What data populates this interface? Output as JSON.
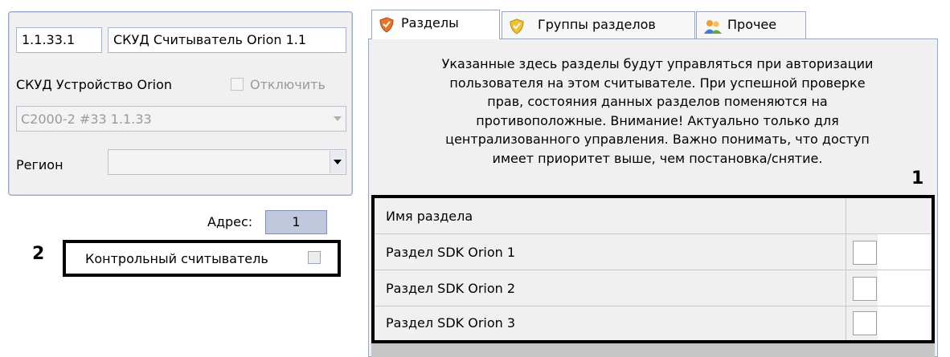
{
  "left": {
    "id_value": "1.1.33.1",
    "name_value": "СКУД Считыватель Orion 1.1",
    "device_label": "СКУД Устройство Orion",
    "disable_label": "Отключить",
    "device_combo_value": "С2000-2 #33 1.1.33",
    "region_label": "Регион",
    "region_value": "",
    "address_label": "Адрес:",
    "address_value": "1",
    "control_reader_label": "Контрольный считыватель",
    "callout_2": "2"
  },
  "tabs": [
    {
      "label": "Разделы",
      "icon": "shield-orange-icon",
      "active": true
    },
    {
      "label": "Группы разделов",
      "icon": "shield-yellow-icon",
      "active": false
    },
    {
      "label": "Прочее",
      "icon": "users-icon",
      "active": false
    }
  ],
  "description_lines": [
    "Указанные здесь разделы будут управляться при авторизации",
    "пользователя на этом считывателе. При успешной проверке",
    "прав, состояния данных разделов поменяются на",
    "противоположные. Внимание! Актуально только для",
    "централизованного управления. Важно понимать, что доступ",
    "имеет приоритет выше, чем постановка/снятие."
  ],
  "callout_1": "1",
  "table": {
    "header": "Имя раздела",
    "rows": [
      {
        "name": "Раздел SDK Orion 1",
        "checked": false
      },
      {
        "name": "Раздел SDK Orion 2",
        "checked": false
      },
      {
        "name": "Раздел SDK Orion 3",
        "checked": false
      }
    ]
  }
}
